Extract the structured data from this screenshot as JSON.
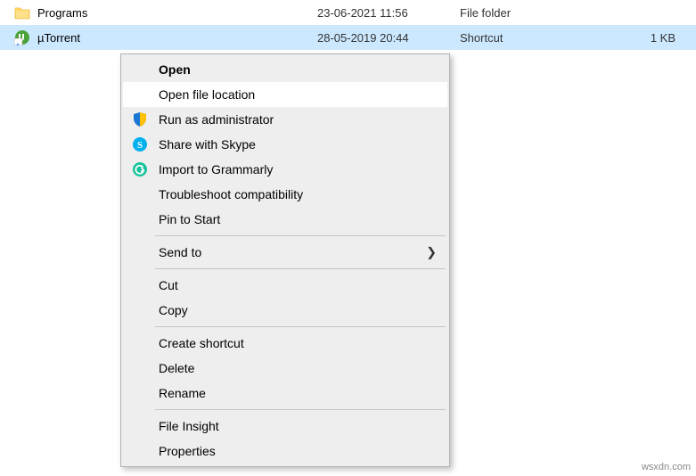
{
  "files": [
    {
      "name": "Programs",
      "date": "23-06-2021 11:56",
      "type": "File folder",
      "size": ""
    },
    {
      "name": "µTorrent",
      "date": "28-05-2019 20:44",
      "type": "Shortcut",
      "size": "1 KB"
    }
  ],
  "context_menu": {
    "open": "Open",
    "open_file_location": "Open file location",
    "run_as_admin": "Run as administrator",
    "share_skype": "Share with Skype",
    "import_grammarly": "Import to Grammarly",
    "troubleshoot": "Troubleshoot compatibility",
    "pin_to_start": "Pin to Start",
    "send_to": "Send to",
    "cut": "Cut",
    "copy": "Copy",
    "create_shortcut": "Create shortcut",
    "delete": "Delete",
    "rename": "Rename",
    "file_insight": "File Insight",
    "properties": "Properties"
  },
  "watermark": "wsxdn.com"
}
